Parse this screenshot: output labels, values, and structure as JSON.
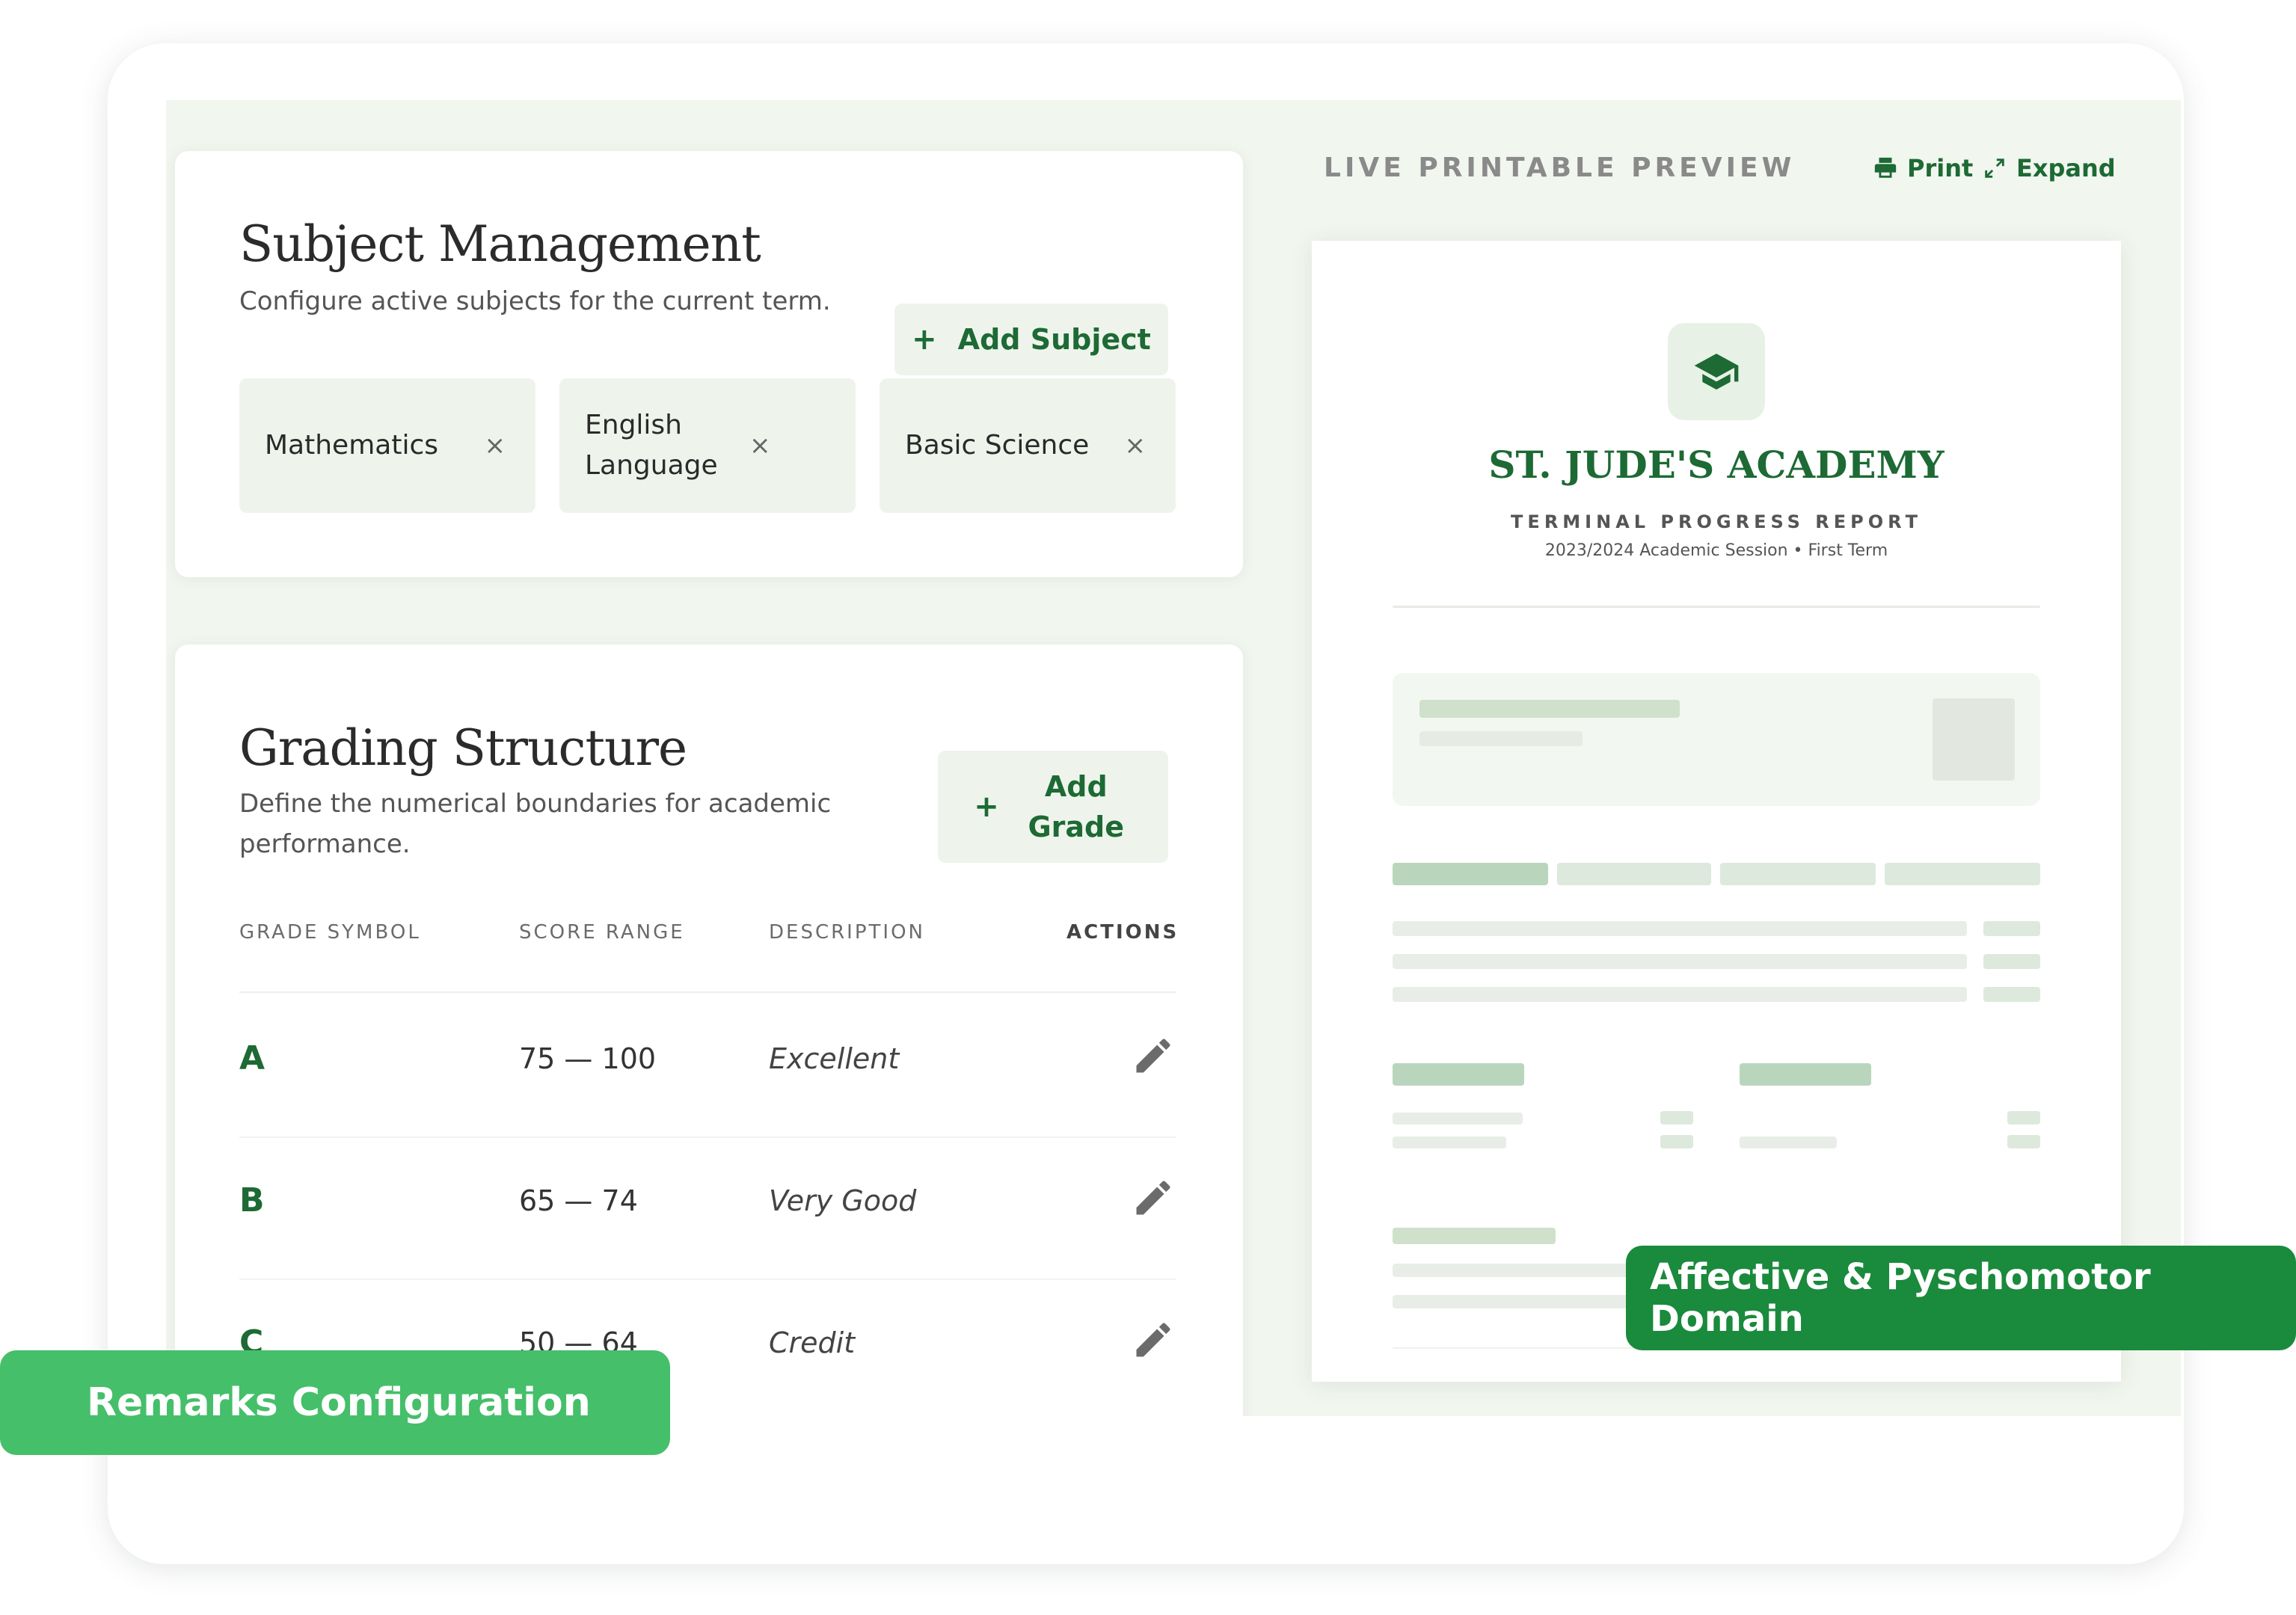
{
  "subjects": {
    "title": "Subject Management",
    "subtitle": "Configure active subjects for the current term.",
    "add_label": "Add Subject",
    "chips": [
      {
        "label": "Mathematics"
      },
      {
        "label": "English Language"
      },
      {
        "label": "Basic Science"
      }
    ],
    "remove_glyph": "×"
  },
  "grading": {
    "title": "Grading Structure",
    "subtitle": "Define the numerical boundaries for academic performance.",
    "add_label": "Add Grade",
    "columns": [
      "GRADE SYMBOL",
      "SCORE RANGE",
      "DESCRIPTION",
      "ACTIONS"
    ],
    "rows": [
      {
        "grade": "A",
        "range": "75 — 100",
        "description": "Excellent"
      },
      {
        "grade": "B",
        "range": "65 — 74",
        "description": "Very Good"
      },
      {
        "grade": "C",
        "range": "50 — 64",
        "description": "Credit"
      }
    ]
  },
  "preview": {
    "label": "LIVE PRINTABLE PREVIEW",
    "print_label": "Print",
    "expand_label": "Expand",
    "school_name": "ST. JUDE'S ACADEMY",
    "report_title": "TERMINAL PROGRESS REPORT",
    "session": "2023/2024 Academic Session • First Term"
  },
  "pills": {
    "remarks": "Remarks Configuration",
    "affective": "Affective & Pyschomotor Domain"
  },
  "icons": {
    "add": "plus-icon",
    "remove": "close-icon",
    "edit": "pencil-icon",
    "print": "printer-icon",
    "expand": "expand-icon",
    "logo": "graduation-cap-icon"
  },
  "colors": {
    "accent": "#1d6a34",
    "soft_green": "#eef4ec",
    "remarks_pill": "#45bf6a",
    "affective_pill": "#1a8a3c"
  }
}
